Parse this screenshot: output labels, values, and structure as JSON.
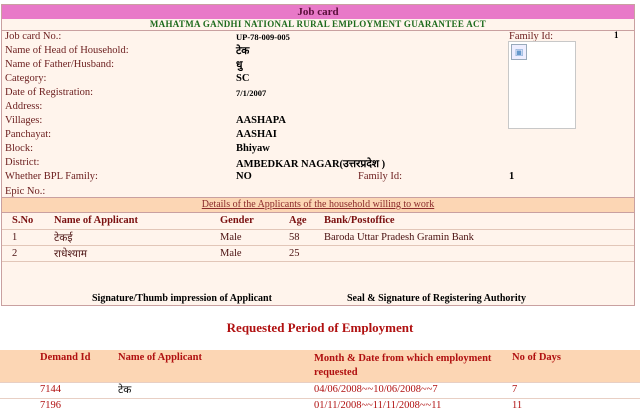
{
  "job_card": {
    "header": "Job card",
    "act": "MAHATMA GANDHI NATIONAL RURAL EMPLOYMENT GUARANTEE ACT",
    "family_id_label": "Family Id:",
    "family_id_value": "1",
    "fields": [
      {
        "label": "Job card No.:",
        "value": "UP-78-009-005"
      },
      {
        "label": "Name of Head of Household:",
        "value": "टेक"
      },
      {
        "label": "Name of Father/Husband:",
        "value": "धु"
      },
      {
        "label": "Category:",
        "value": "SC"
      },
      {
        "label": "Date of Registration:",
        "value": "7/1/2007"
      },
      {
        "label": "Address:",
        "value": ""
      },
      {
        "label": "Villages:",
        "value": "AASHAPA"
      },
      {
        "label": "Panchayat:",
        "value": "AASHAI"
      },
      {
        "label": "Block:",
        "value": "Bhiyaw"
      },
      {
        "label": "District:",
        "value": "AMBEDKAR NAGAR(उत्तरप्रदेश )"
      },
      {
        "label": "Whether BPL Family:",
        "value": "NO"
      },
      {
        "label": "Epic No.:",
        "value": ""
      }
    ],
    "family_id_label_2": "Family Id:",
    "family_id_value_2": "1",
    "details_title": "Details of the Applicants of the household willing to work",
    "applicants": {
      "headers": [
        "S.No",
        "Name of Applicant",
        "Gender",
        "Age",
        "Bank/Postoffice"
      ],
      "rows": [
        [
          "1",
          "टेकई",
          "Male",
          "58",
          "Baroda Uttar Pradesh Gramin Bank"
        ],
        [
          "2",
          "राधेश्याम",
          "Male",
          "25",
          ""
        ]
      ]
    },
    "signature_applicant": "Signature/Thumb impression of Applicant",
    "signature_authority": "Seal & Signature of Registering Authority"
  },
  "employment": {
    "title": "Requested Period of Employment",
    "headers": [
      "Demand Id",
      "Name of Applicant",
      "Month & Date from which employment requested",
      "No of Days"
    ],
    "rows": [
      [
        "7144",
        "टेक",
        "04/06/2008~~10/06/2008~~7",
        "7"
      ],
      [
        "7196",
        "",
        "01/11/2008~~11/11/2008~~11",
        "11"
      ]
    ]
  },
  "icons": {
    "photo": "broken-image-icon"
  }
}
